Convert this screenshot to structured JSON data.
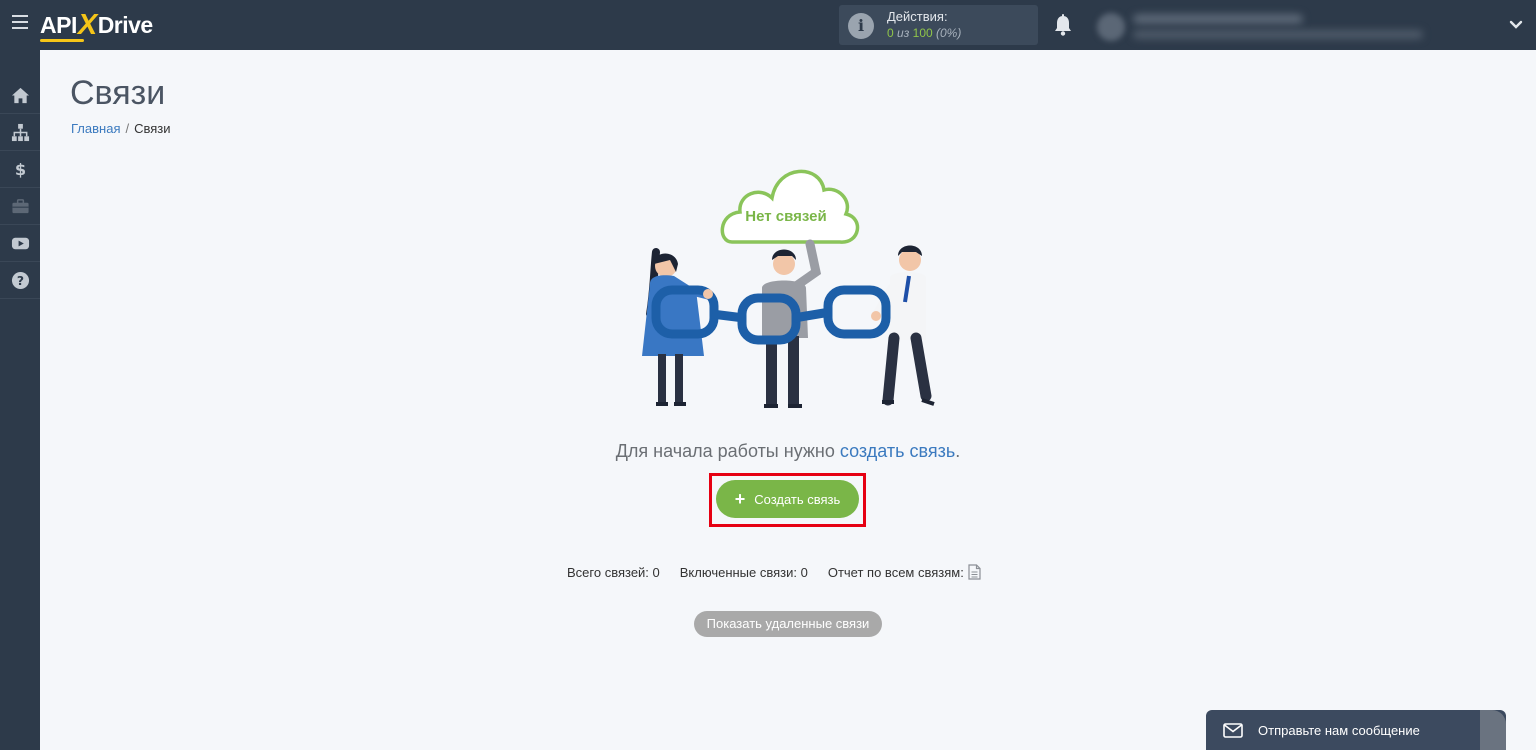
{
  "header": {
    "logo": {
      "left": "API",
      "x": "X",
      "right": "Drive"
    },
    "actions": {
      "label": "Действия:",
      "used": "0",
      "of": "из",
      "total": "100",
      "percent": "(0%)"
    },
    "icons": [
      "menu-icon",
      "info-icon",
      "bell-icon",
      "chevron-down-icon"
    ]
  },
  "sidebar": {
    "items": [
      {
        "name": "home",
        "icon": "home-icon"
      },
      {
        "name": "connections",
        "icon": "sitemap-icon"
      },
      {
        "name": "billing",
        "icon": "dollar-icon"
      },
      {
        "name": "tools",
        "icon": "briefcase-icon"
      },
      {
        "name": "video",
        "icon": "youtube-icon"
      },
      {
        "name": "help",
        "icon": "question-icon"
      }
    ]
  },
  "page": {
    "title": "Связи",
    "breadcrumb": {
      "home": "Главная",
      "separator": "/",
      "current": "Связи"
    }
  },
  "empty_state": {
    "cloud_text": "Нет связей",
    "hint_before": "Для начала работы нужно ",
    "hint_link": "создать связь",
    "hint_after": ".",
    "create_button": "Создать связь",
    "create_button_icon": "+"
  },
  "stats": {
    "total": "Всего связей: 0",
    "enabled": "Включенные связи: 0",
    "report": "Отчет по всем связям:"
  },
  "show_deleted": "Показать удаленные связи",
  "chat_widget": {
    "label": "Отправьте нам сообщение",
    "icon": "envelope-icon"
  },
  "colors": {
    "topbar": "#2d3a4a",
    "accent_green": "#7ab648",
    "link_blue": "#3b7abf",
    "highlight_red": "#e60012"
  }
}
